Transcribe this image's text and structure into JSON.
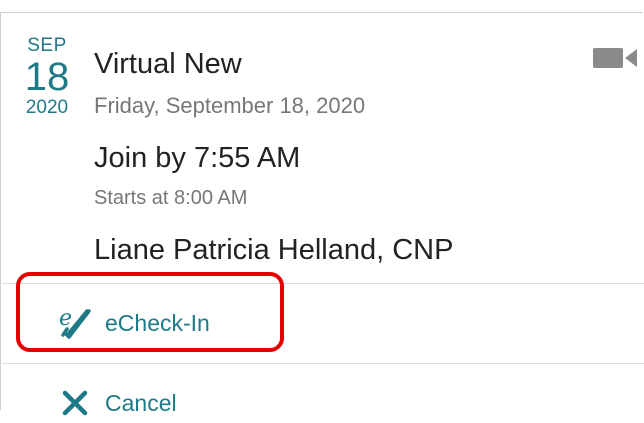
{
  "appointment": {
    "date": {
      "month": "SEP",
      "day": "18",
      "year": "2020"
    },
    "title": "Virtual New",
    "full_date": "Friday, September 18, 2020",
    "join_by": "Join by 7:55 AM",
    "starts_at": "Starts at 8:00 AM",
    "provider": "Liane Patricia Helland, CNP",
    "type_icon": "video-camera-icon"
  },
  "actions": {
    "echeckin": {
      "label": "eCheck-In",
      "icon": "echeckin-icon"
    },
    "cancel": {
      "label": "Cancel",
      "icon": "close-icon"
    }
  },
  "colors": {
    "accent": "#1e7a86",
    "highlight": "#e50000",
    "text_primary": "#222222",
    "text_secondary": "#777777"
  }
}
